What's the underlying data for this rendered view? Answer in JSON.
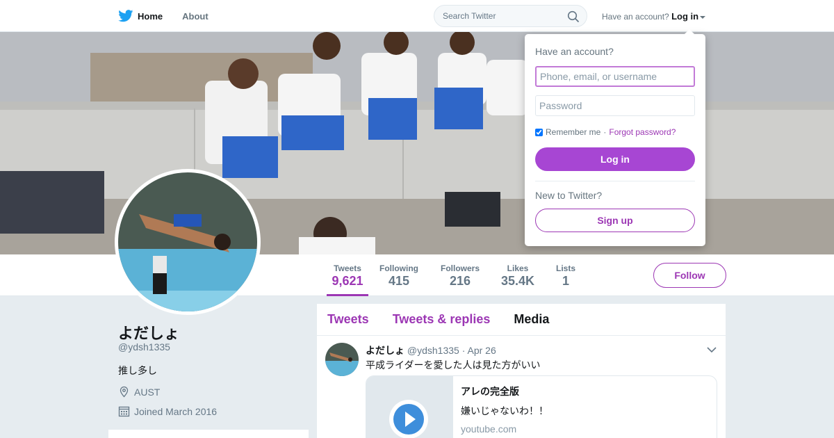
{
  "nav": {
    "home_label": "Home",
    "about_label": "About",
    "search_placeholder": "Search Twitter",
    "account_question": "Have an account?",
    "login_label": "Log in"
  },
  "profile": {
    "name": "よだしょ",
    "handle": "@ydsh1335",
    "bio": "推し多し",
    "location": "AUST",
    "joined": "Joined March 2016"
  },
  "stats": [
    {
      "label": "Tweets",
      "value": "9,621"
    },
    {
      "label": "Following",
      "value": "415"
    },
    {
      "label": "Followers",
      "value": "216"
    },
    {
      "label": "Likes",
      "value": "35.4K"
    },
    {
      "label": "Lists",
      "value": "1"
    }
  ],
  "follow_label": "Follow",
  "timeline": {
    "tabs": [
      "Tweets",
      "Tweets & replies",
      "Media"
    ],
    "tweet": {
      "name": "よだしょ",
      "handle": "@ydsh1335",
      "date": "· Apr 26",
      "text": "平成ライダーを愛した人は見た方がいい",
      "card": {
        "title": "アレの完全版",
        "description": "嫌いじゃないわ！！",
        "url": "youtube.com"
      }
    }
  },
  "login_dropdown": {
    "title": "Have an account?",
    "username_placeholder": "Phone, email, or username",
    "password_placeholder": "Password",
    "remember_label": "Remember me",
    "separator": " · ",
    "forgot_label": "Forgot password?",
    "login_button": "Log in",
    "new_to": "New to Twitter?",
    "signup_button": "Sign up"
  },
  "colors": {
    "accent": "#9c37b4",
    "login_button": "#a746d3",
    "twitter_blue": "#1da1f2"
  }
}
